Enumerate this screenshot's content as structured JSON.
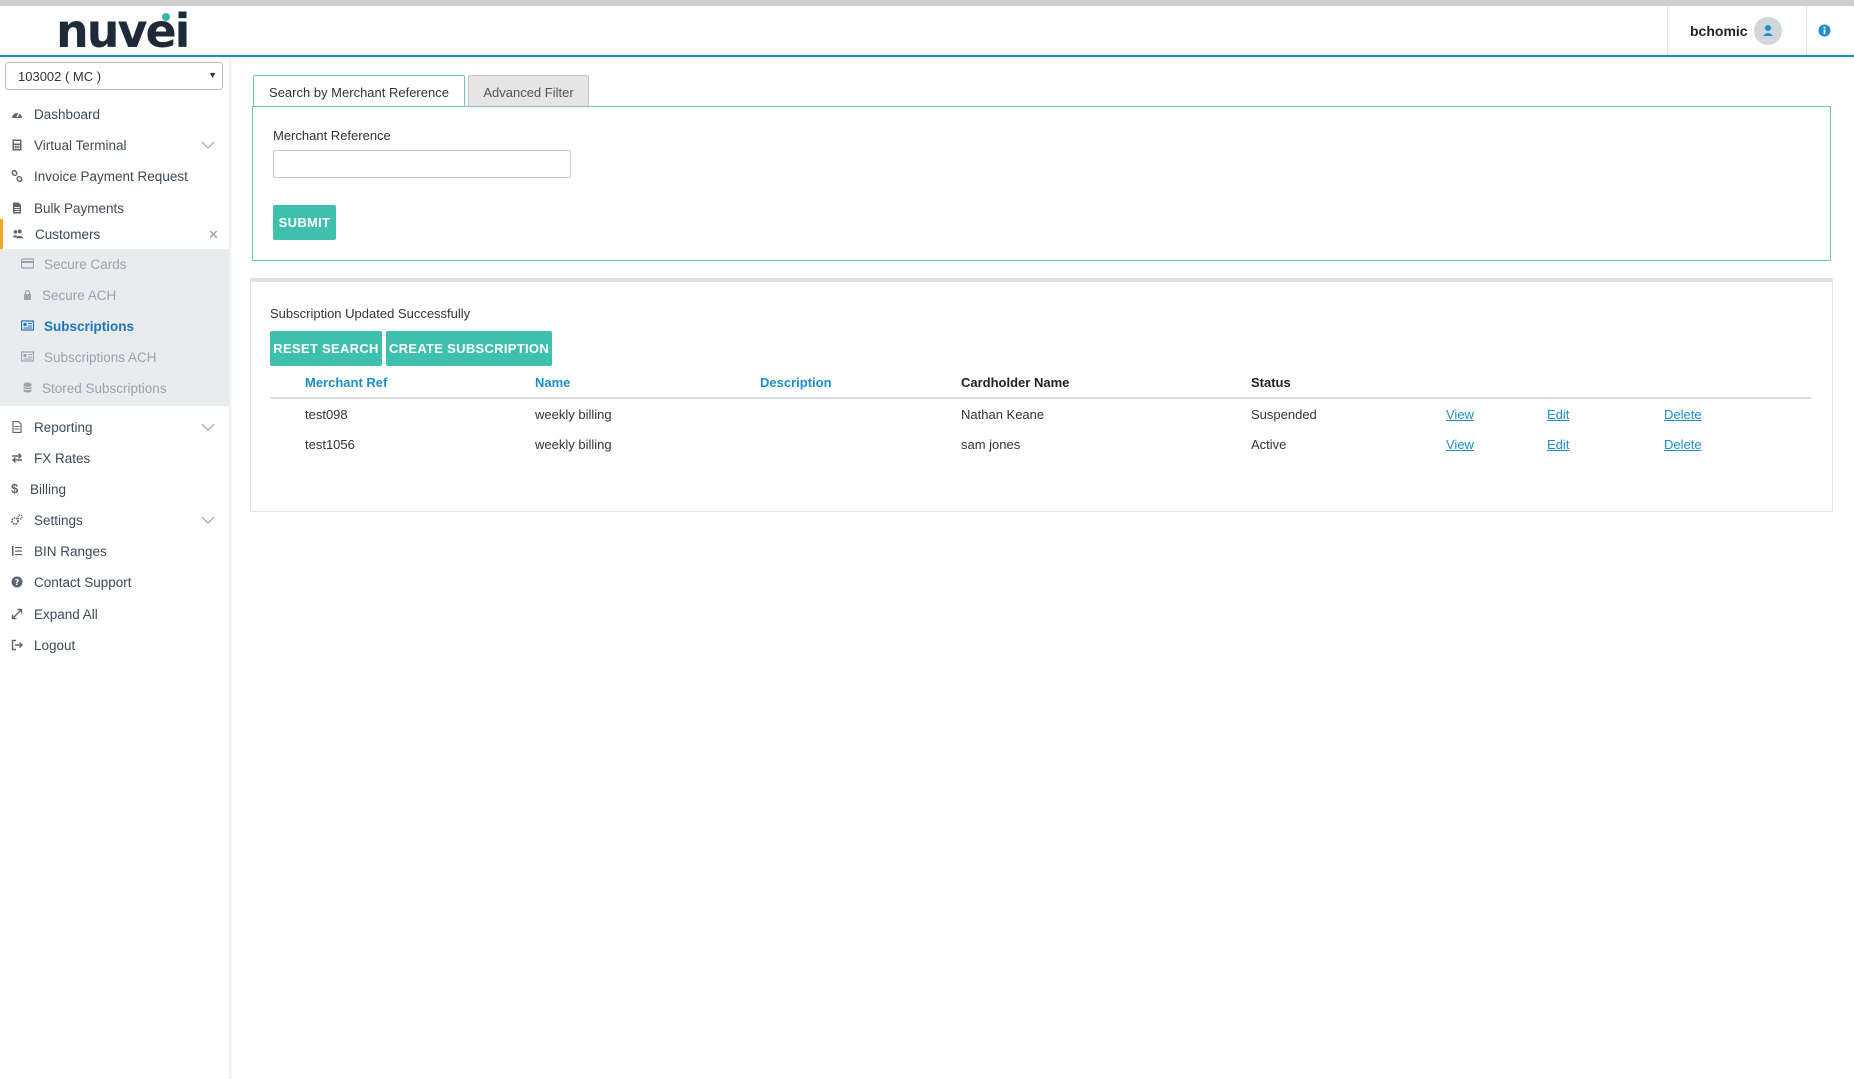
{
  "header": {
    "logo_text": "nuvei",
    "username": "bchomic"
  },
  "sidebar": {
    "account_selector": "103002 ( MC )",
    "items": [
      {
        "label": "Dashboard",
        "icon": "dashboard-icon"
      },
      {
        "label": "Virtual Terminal",
        "icon": "calculator-icon",
        "expandable": true
      },
      {
        "label": "Invoice Payment Request",
        "icon": "link-icon"
      },
      {
        "label": "Bulk Payments",
        "icon": "file-icon"
      },
      {
        "label": "Customers",
        "icon": "users-icon",
        "expanded": true
      },
      {
        "label": "Reporting",
        "icon": "report-icon",
        "expandable": true
      },
      {
        "label": "FX Rates",
        "icon": "exchange-icon"
      },
      {
        "label": "Billing",
        "icon": "dollar-icon"
      },
      {
        "label": "Settings",
        "icon": "cogs-icon",
        "expandable": true
      },
      {
        "label": "BIN Ranges",
        "icon": "list-icon"
      },
      {
        "label": "Contact Support",
        "icon": "question-icon"
      },
      {
        "label": "Expand All",
        "icon": "expand-icon"
      },
      {
        "label": "Logout",
        "icon": "logout-icon"
      }
    ],
    "customers_sub": [
      {
        "label": "Secure Cards",
        "icon": "credit-card-icon"
      },
      {
        "label": "Secure ACH",
        "icon": "lock-icon"
      },
      {
        "label": "Subscriptions",
        "icon": "subscription-icon",
        "current": true
      },
      {
        "label": "Subscriptions ACH",
        "icon": "subscription-ach-icon"
      },
      {
        "label": "Stored Subscriptions",
        "icon": "database-icon"
      }
    ]
  },
  "tabs": {
    "search_by_ref": "Search by Merchant Reference",
    "advanced_filter": "Advanced Filter"
  },
  "search": {
    "label": "Merchant Reference",
    "value": "",
    "submit": "SUBMIT"
  },
  "results": {
    "message": "Subscription Updated Successfully",
    "reset_button": "RESET SEARCH",
    "create_button": "CREATE SUBSCRIPTION",
    "columns": {
      "merchant_ref": "Merchant Ref",
      "name": "Name",
      "description": "Description",
      "cardholder": "Cardholder Name",
      "status": "Status"
    },
    "rows": [
      {
        "merchant_ref": "test098",
        "name": "weekly billing",
        "description": "",
        "cardholder": "Nathan Keane",
        "status": "Suspended",
        "view": "View",
        "edit": "Edit",
        "delete": "Delete"
      },
      {
        "merchant_ref": "test1056",
        "name": "weekly billing",
        "description": "",
        "cardholder": "sam jones",
        "status": "Active",
        "view": "View",
        "edit": "Edit",
        "delete": "Delete"
      }
    ]
  },
  "colors": {
    "accent_blue": "#1d8ec9",
    "teal_button": "#3fbfad",
    "active_marker": "#f5a623"
  }
}
